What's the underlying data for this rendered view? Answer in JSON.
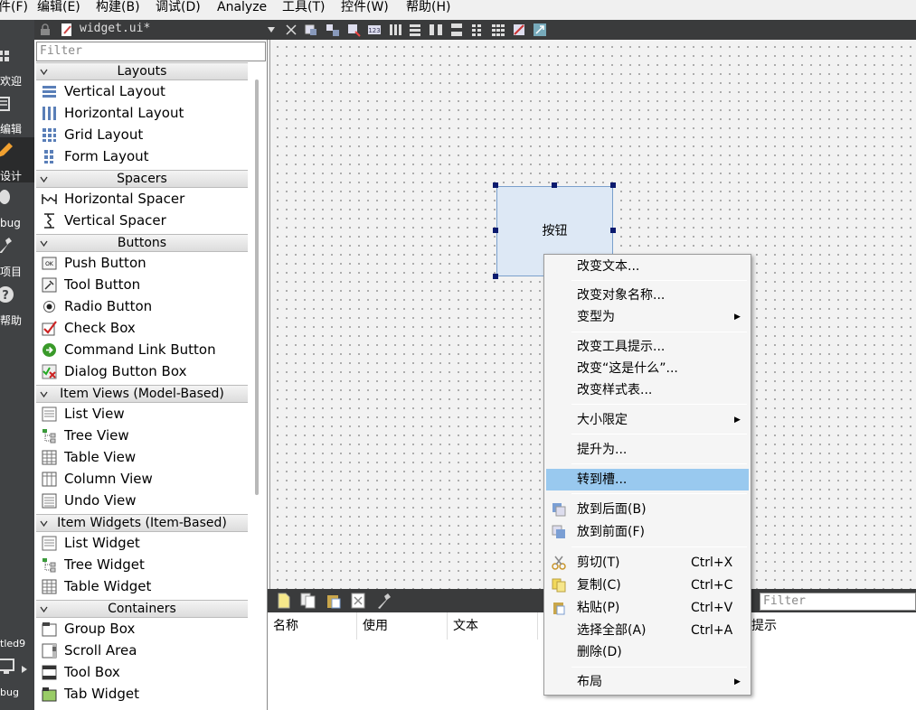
{
  "menubar": {
    "file": "件(F)",
    "edit": "编辑(E)",
    "build": "构建(B)",
    "debug": "调试(D)",
    "analyze": "Analyze",
    "tools": "工具(T)",
    "widgets": "控件(W)",
    "help": "帮助(H)"
  },
  "modes": {
    "welcome": "欢迎",
    "edit": "编辑",
    "design": "设计",
    "debug": "bug",
    "projects": "项目",
    "help": "帮助",
    "project_name": "tled9",
    "target_debug": "bug"
  },
  "editor": {
    "document": "widget.ui*"
  },
  "widgetbox": {
    "filter_placeholder": "Filter",
    "categories": [
      {
        "title": "Layouts",
        "items": [
          "Vertical Layout",
          "Horizontal Layout",
          "Grid Layout",
          "Form Layout"
        ]
      },
      {
        "title": "Spacers",
        "items": [
          "Horizontal Spacer",
          "Vertical Spacer"
        ]
      },
      {
        "title": "Buttons",
        "items": [
          "Push Button",
          "Tool Button",
          "Radio Button",
          "Check Box",
          "Command Link Button",
          "Dialog Button Box"
        ]
      },
      {
        "title": "Item Views (Model-Based)",
        "items": [
          "List View",
          "Tree View",
          "Table View",
          "Column View",
          "Undo View"
        ]
      },
      {
        "title": "Item Widgets (Item-Based)",
        "items": [
          "List Widget",
          "Tree Widget",
          "Table Widget"
        ]
      },
      {
        "title": "Containers",
        "items": [
          "Group Box",
          "Scroll Area",
          "Tool Box",
          "Tab Widget"
        ]
      }
    ]
  },
  "form": {
    "button_text": "按钮"
  },
  "action_editor": {
    "filter_placeholder": "Filter",
    "columns": [
      "名称",
      "使用",
      "文本"
    ],
    "tooltip_col": "提示"
  },
  "context_menu": {
    "change_text": "改变文本...",
    "change_object_name": "改变对象名称...",
    "morph_into": "变型为",
    "change_tooltip": "改变工具提示...",
    "change_whats_this": "改变“这是什么”...",
    "change_stylesheet": "改变样式表...",
    "size_constraints": "大小限定",
    "promote_to": "提升为...",
    "go_to_slot": "转到槽...",
    "send_to_back": "放到后面(B)",
    "bring_to_front": "放到前面(F)",
    "cut": "剪切(T)",
    "cut_shortcut": "Ctrl+X",
    "copy": "复制(C)",
    "copy_shortcut": "Ctrl+C",
    "paste": "粘贴(P)",
    "paste_shortcut": "Ctrl+V",
    "select_all": "选择全部(A)",
    "select_all_shortcut": "Ctrl+A",
    "delete": "删除(D)",
    "layout": "布局",
    "highlight_color": "#99c9ef"
  }
}
